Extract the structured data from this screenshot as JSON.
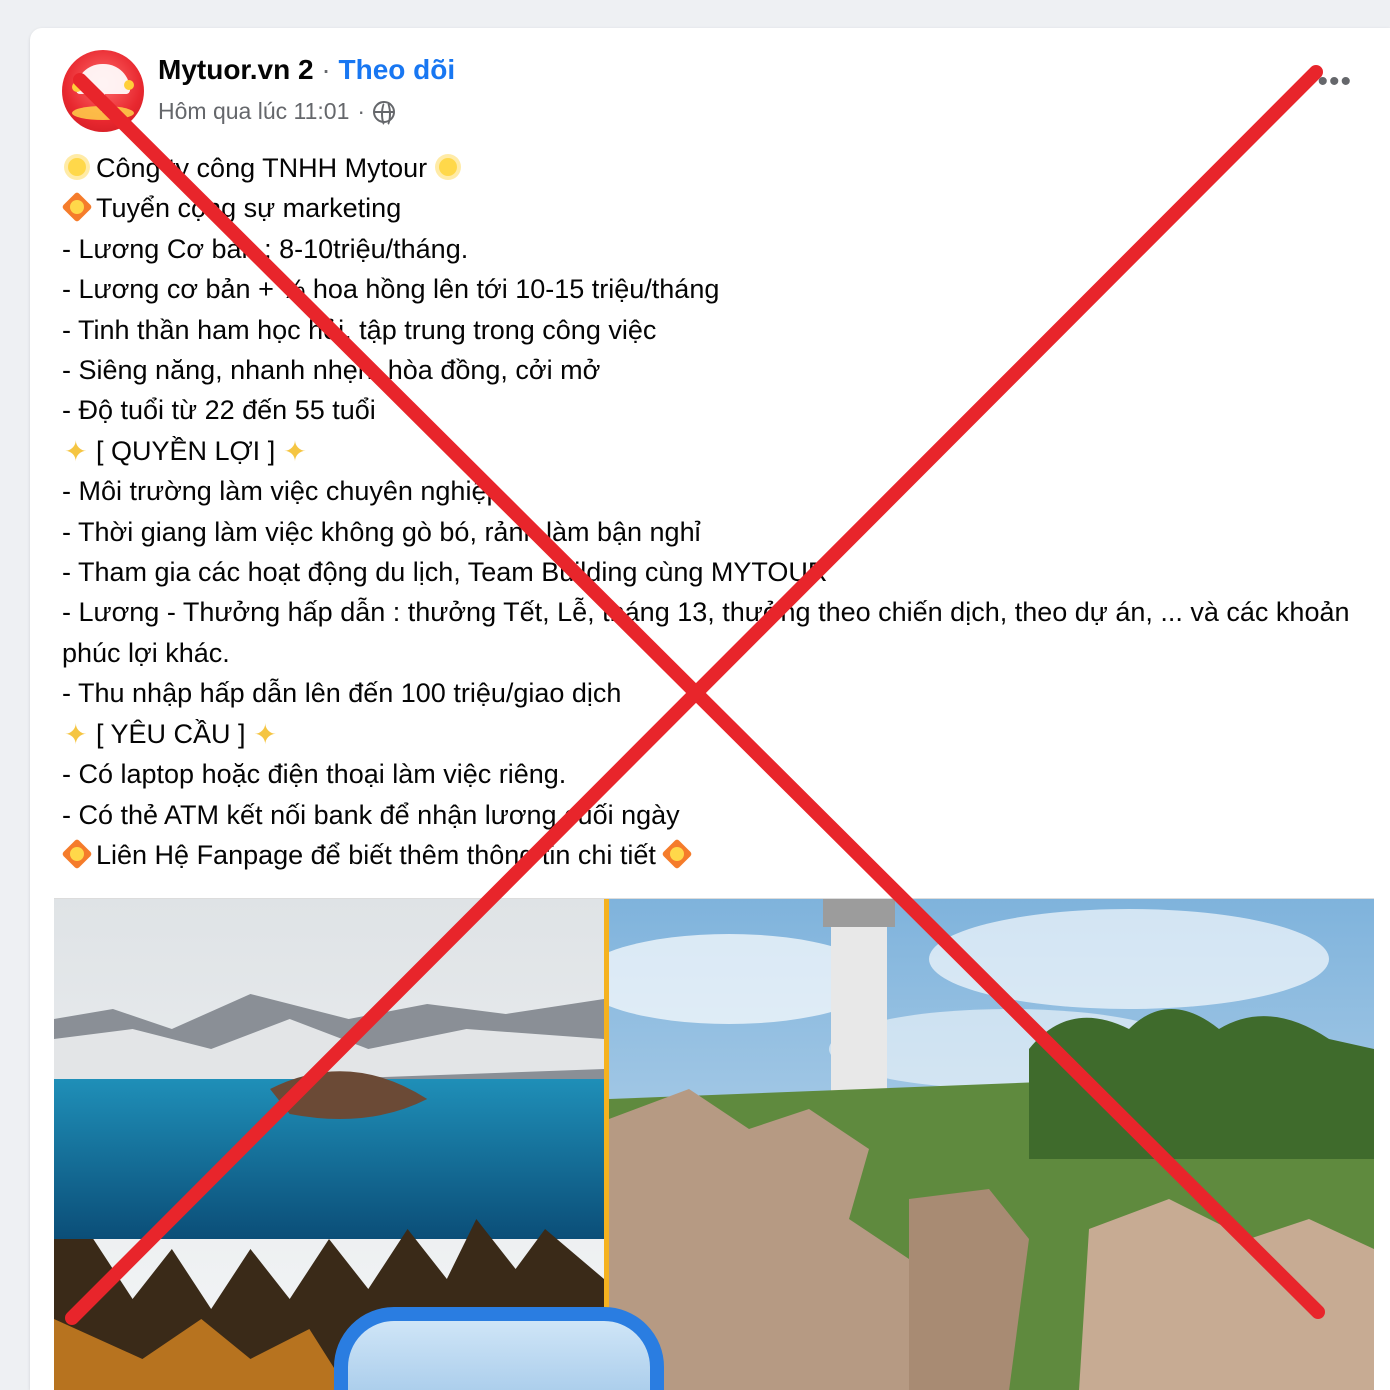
{
  "post": {
    "author": "Mytuor.vn 2",
    "separator": "·",
    "follow": "Theo dõi",
    "timestamp": "Hôm qua lúc 11:01",
    "meta_separator": "·",
    "lines": [
      {
        "text": "Công ty công TNHH Mytour",
        "emoji_before": "sun",
        "emoji_after": "sun"
      },
      {
        "text": "Tuyển cộng sự marketing",
        "emoji_before": "burst"
      },
      {
        "text": "- Lương Cơ bản : 8-10triệu/tháng."
      },
      {
        "text": "- Lương cơ bản + % hoa hồng lên tới 10-15 triệu/tháng"
      },
      {
        "text": "- Tinh thần ham học hỏi, tập trung trong công việc"
      },
      {
        "text": "- Siêng năng, nhanh nhẹn, hòa đồng, cởi mở"
      },
      {
        "text": "- Độ tuổi từ 22 đến 55 tuổi"
      },
      {
        "text": "[ QUYỀN LỢI ]",
        "emoji_before": "sparkle",
        "emoji_after": "sparkle"
      },
      {
        "text": "- Môi trường làm việc chuyên nghiệp."
      },
      {
        "text": "- Thời giang làm việc không gò bó, rảnh làm bận nghỉ"
      },
      {
        "text": "- Tham gia các hoạt động du lịch, Team Building cùng MYTOUR"
      },
      {
        "text": "- Lương - Thưởng hấp dẫn : thưởng Tết, Lễ, tháng 13, thưởng theo chiến dịch, theo dự án, ... và các khoản phúc lợi khác.",
        "wrap": true
      },
      {
        "text": "- Thu nhập hấp dẫn lên đến 100 triệu/giao dịch"
      },
      {
        "text": "[ YÊU CẦU ]",
        "emoji_before": "sparkle",
        "emoji_after": "sparkle"
      },
      {
        "text": "- Có laptop hoặc điện thoại làm việc riêng."
      },
      {
        "text": "- Có thẻ ATM kết nối bank để nhận lương cuối ngày"
      },
      {
        "text": "Liên Hệ Fanpage để biết thêm thông tin chi tiết",
        "emoji_before": "burst",
        "emoji_after": "burst"
      }
    ]
  },
  "icons": {
    "avatar": "mytour-umbrella-logo",
    "privacy": "globe-icon",
    "more": "more-options-icon"
  },
  "colors": {
    "follow": "#1877f2",
    "x_mark": "#e8252b",
    "photo_frame": "#f5b21f"
  }
}
